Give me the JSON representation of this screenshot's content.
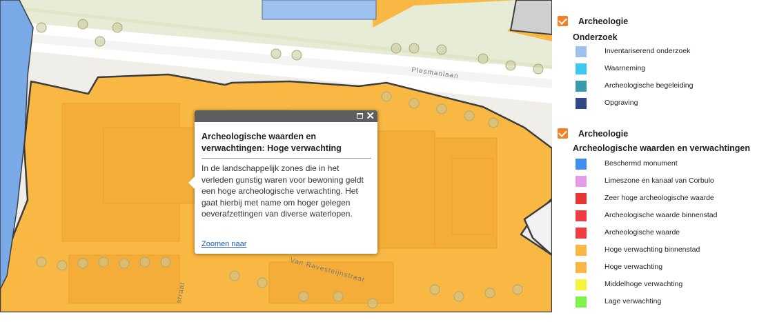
{
  "map": {
    "street_labels": [
      "Plesmanlaan",
      "Van Ravesteijnstraat",
      "straat"
    ],
    "colors": {
      "high_expectation_fill": "#f9b743",
      "boundary": "#3d3d3d",
      "background": "#efeee9",
      "road": "#ffffff",
      "green": "#dfe6c8",
      "blue_area": "#79a9e6"
    }
  },
  "popup": {
    "title": "Archeologische waarden en verwachtingen: Hoge verwachting",
    "body": "In de landschappelijk zones die in het verleden gunstig waren voor bewoning geldt een hoge archeologische verwachting. Het gaat hierbij met name om hoger gelegen oeverafzettingen van diverse waterlopen.",
    "link": "Zoomen naar",
    "maximize_icon": "maximize-icon",
    "close_icon": "close-icon",
    "close_glyph": "✕"
  },
  "legend": {
    "groups": [
      {
        "title": "Archeologie",
        "checked": true,
        "subtitle": "Onderzoek",
        "items": [
          {
            "label": "Inventariserend onderzoek",
            "color": "#9ec2f0"
          },
          {
            "label": "Waarneming",
            "color": "#3cc9f0"
          },
          {
            "label": "Archeologische begeleiding",
            "color": "#3a9aad"
          },
          {
            "label": "Opgraving",
            "color": "#2f4a87"
          }
        ]
      },
      {
        "title": "Archeologie",
        "checked": true,
        "subtitle": "Archeologische waarden en verwachtingen",
        "items": [
          {
            "label": "Beschermd monument",
            "color": "#3f8ef0"
          },
          {
            "label": "Limeszone en kanaal van Corbulo",
            "color": "#e59be8"
          },
          {
            "label": "Zeer hoge archeologische waarde",
            "color": "#e8353a"
          },
          {
            "label": "Archeologische waarde binnenstad",
            "color": "#f23c44"
          },
          {
            "label": "Archeologische waarde",
            "color": "#f23c44"
          },
          {
            "label": "Hoge verwachting binnenstad",
            "color": "#f9b743"
          },
          {
            "label": "Hoge verwachting",
            "color": "#f9b743"
          },
          {
            "label": "Middelhoge verwachting",
            "color": "#f6f53a"
          },
          {
            "label": "Lage verwachting",
            "color": "#7ef34a"
          }
        ]
      }
    ]
  }
}
